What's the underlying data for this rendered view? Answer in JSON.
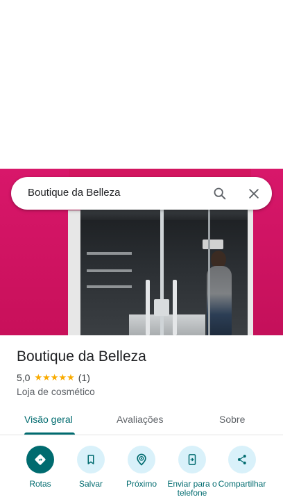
{
  "search": {
    "query": "Boutique da Belleza"
  },
  "place": {
    "name": "Boutique da Belleza",
    "rating": "5,0",
    "stars": 5,
    "review_count": "(1)",
    "category": "Loja de cosmético"
  },
  "tabs": [
    {
      "label": "Visão geral",
      "active": true
    },
    {
      "label": "Avaliações",
      "active": false
    },
    {
      "label": "Sobre",
      "active": false
    }
  ],
  "actions": [
    {
      "label": "Rotas",
      "icon": "directions-icon",
      "primary": true
    },
    {
      "label": "Salvar",
      "icon": "bookmark-icon",
      "primary": false
    },
    {
      "label": "Próximo",
      "icon": "nearby-icon",
      "primary": false
    },
    {
      "label": "Enviar para o telefone",
      "icon": "send-to-phone-icon",
      "primary": false
    },
    {
      "label": "Compartilhar",
      "icon": "share-icon",
      "primary": false
    }
  ],
  "colors": {
    "accent": "#006b6f",
    "action_bg": "#d9f1fa",
    "star": "#f9ab00",
    "storefront_pink": "#d2155f"
  }
}
